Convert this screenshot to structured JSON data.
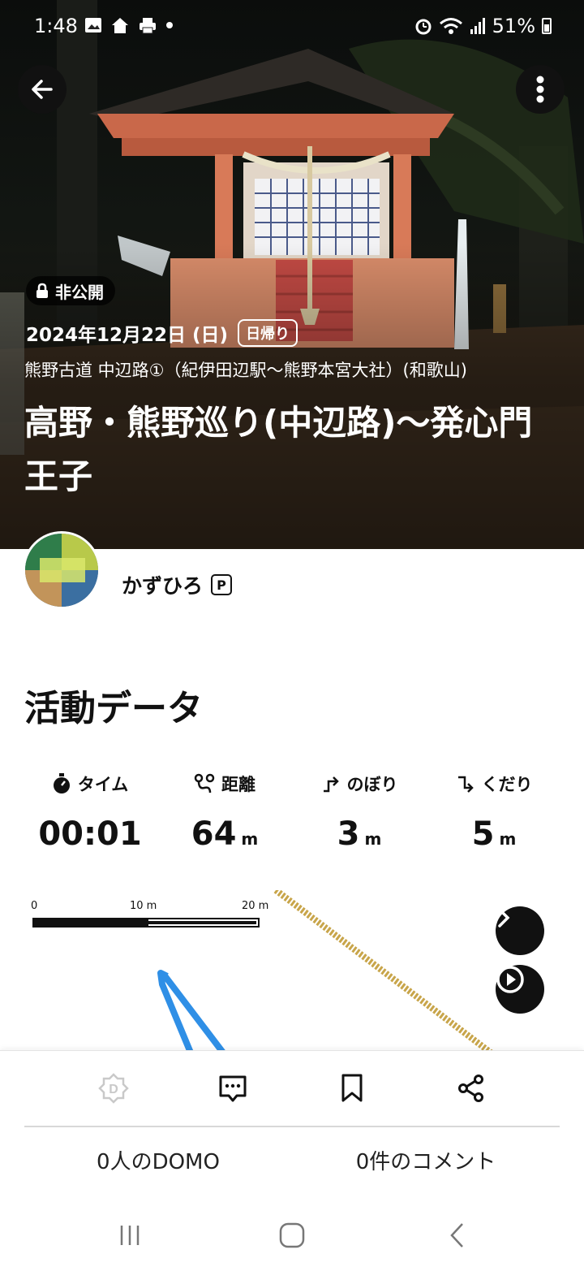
{
  "status_bar": {
    "time": "1:48",
    "battery": "51%",
    "left_icons": [
      "image-icon",
      "home-icon",
      "printer-icon",
      "dot-icon"
    ],
    "right_icons": [
      "alarm-icon",
      "wifi-icon",
      "signal-icon",
      "battery-icon"
    ]
  },
  "hero": {
    "private_label": "非公開",
    "date": "2024年12月22日 (日)",
    "trip_type": "日帰り",
    "route_name": "熊野古道 中辺路①（紀伊田辺駅〜熊野本宮大社）(和歌山)",
    "title": "高野・熊野巡り(中辺路)〜発心門王子"
  },
  "user": {
    "name": "かずひろ",
    "badge": "P"
  },
  "activity": {
    "title": "活動データ",
    "stats": [
      {
        "label": "タイム",
        "value": "00:01",
        "unit": "",
        "icon": "stopwatch-icon"
      },
      {
        "label": "距離",
        "value": "64",
        "unit": "m",
        "icon": "route-icon"
      },
      {
        "label": "のぼり",
        "value": "3",
        "unit": "m",
        "icon": "ascent-icon"
      },
      {
        "label": "くだり",
        "value": "5",
        "unit": "m",
        "icon": "descent-icon"
      }
    ]
  },
  "map": {
    "scale_labels": [
      "0",
      "10 m",
      "20 m"
    ],
    "colors": {
      "track": "#2f8fe6",
      "trail": "#c8a54a"
    }
  },
  "bottom_bar": {
    "domo_count": "0人のDOMO",
    "comment_count": "0件のコメント",
    "icons": [
      "domo-icon",
      "comment-icon",
      "bookmark-icon",
      "share-icon"
    ]
  }
}
